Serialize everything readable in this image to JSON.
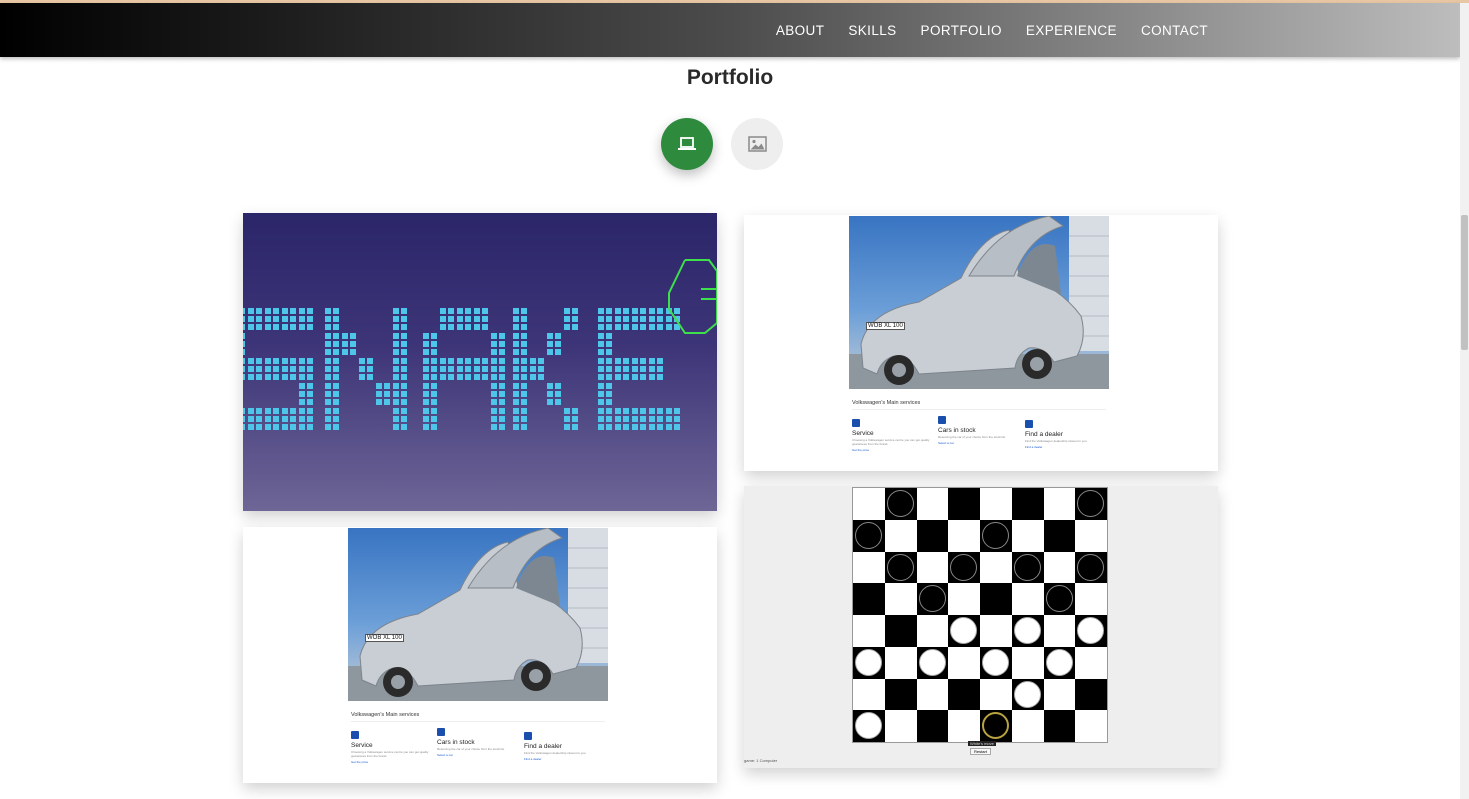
{
  "navbar": {
    "links": [
      "ABOUT",
      "SKILLS",
      "PORTFOLIO",
      "EXPERIENCE",
      "CONTACT"
    ]
  },
  "portfolio": {
    "title": "Portfolio",
    "filters": [
      {
        "icon": "laptop-icon",
        "active": true,
        "color": "#2e8b3e"
      },
      {
        "icon": "image-icon",
        "active": false,
        "color": "#eeeeee"
      }
    ]
  },
  "projects": {
    "snake": {
      "title_art": "SNAKE"
    },
    "vw": {
      "heading": "Volkswagen's Main services",
      "plate": "WOB XL 100",
      "services": [
        {
          "title": "Service",
          "text": "Choosing a Volkswagen service centre you can get quality guarantees from the brand.",
          "link": "Get the price"
        },
        {
          "title": "Cars in stock",
          "text": "Reserving the car of your choice from the stock list",
          "link": "Select a car"
        },
        {
          "title": "Find a dealer",
          "text": "Find the Volkswagen dealership closest to you.",
          "link": "Find a dealer"
        }
      ]
    },
    "checkers": {
      "turn_label": "White's move",
      "restart_label": "Restart",
      "option_label": "game:  1   Computer"
    }
  }
}
